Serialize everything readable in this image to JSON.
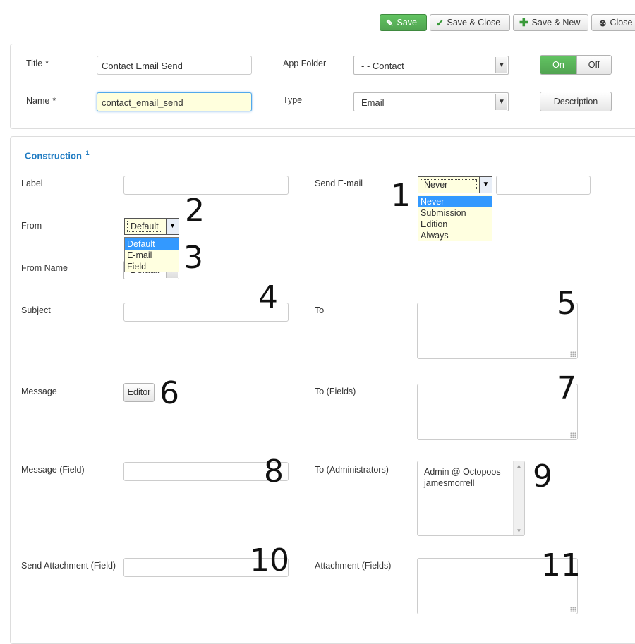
{
  "toolbar": {
    "save": "Save",
    "save_close": "Save & Close",
    "save_new": "Save & New",
    "close": "Close"
  },
  "header": {
    "title_label": "Title",
    "title_value": "Contact Email Send",
    "name_label": "Name",
    "name_value": "contact_email_send",
    "required_mark": "*",
    "app_folder_label": "App Folder",
    "app_folder_value": "- - Contact",
    "type_label": "Type",
    "type_value": "Email",
    "toggle_on": "On",
    "toggle_off": "Off",
    "description_button": "Description"
  },
  "construction": {
    "heading": "Construction",
    "heading_sup": "1",
    "label_label": "Label",
    "from_label": "From",
    "from_value": "Default",
    "from_options": [
      "Default",
      "E-mail",
      "Field"
    ],
    "from_name_label": "From Name",
    "from_name_value": "Default",
    "subject_label": "Subject",
    "message_label": "Message",
    "editor_button": "Editor",
    "message_field_label": "Message (Field)",
    "send_attachment_label": "Send Attachment (Field)",
    "send_email_label": "Send E-mail",
    "send_email_value": "Never",
    "send_email_options": [
      "Never",
      "Submission",
      "Edition",
      "Always"
    ],
    "to_label": "To",
    "to_fields_label": "To (Fields)",
    "to_admins_label": "To (Administrators)",
    "admins": [
      "Admin @ Octopoos",
      "jamesmorrell"
    ],
    "attachment_fields_label": "Attachment (Fields)"
  },
  "annotations": [
    "1",
    "2",
    "3",
    "4",
    "5",
    "6",
    "7",
    "8",
    "9",
    "10",
    "11"
  ],
  "colors": {
    "accent_green": "#51a351",
    "heading_blue": "#1f7bc2",
    "dropdown_highlight": "#3399ff",
    "focus_bg": "#ffffdd"
  }
}
